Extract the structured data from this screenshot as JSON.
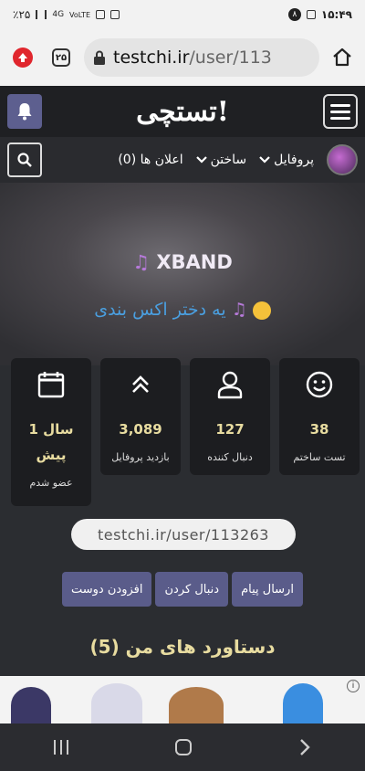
{
  "status": {
    "time": "۱۵:۴۹",
    "notif_count": "۸",
    "battery_left": "٪۲۵",
    "network": "4G",
    "volte": "VoLTE"
  },
  "browser": {
    "tab_count": "۲۵",
    "url_domain": "testchi.ir",
    "url_path": "/user/113"
  },
  "site": {
    "logo": "تستچی!"
  },
  "nav": {
    "profile_label": "پروفایل",
    "build_label": "ساختن",
    "notifications_label": "اعلان ها (0)"
  },
  "profile": {
    "name": "XBAND",
    "bio": "یه دختر اکس بندی"
  },
  "stats": [
    {
      "value": "38",
      "label": "تست ساختم",
      "icon": "smile-icon"
    },
    {
      "value": "127",
      "label": "دنبال کننده",
      "icon": "user-icon"
    },
    {
      "value": "3,089",
      "label": "بازدید پروفایل",
      "icon": "double-chevron-up-icon"
    },
    {
      "value": "1 سال پیش",
      "label": "عضو شدم",
      "icon": "calendar-icon"
    }
  ],
  "profile_url": "testchi.ir/user/113263",
  "actions": {
    "message": "ارسال پیام",
    "follow": "دنبال کردن",
    "add_friend": "افزودن دوست"
  },
  "achievements_title": "دستاورد های من (5)",
  "ad": {
    "badge": "i"
  }
}
